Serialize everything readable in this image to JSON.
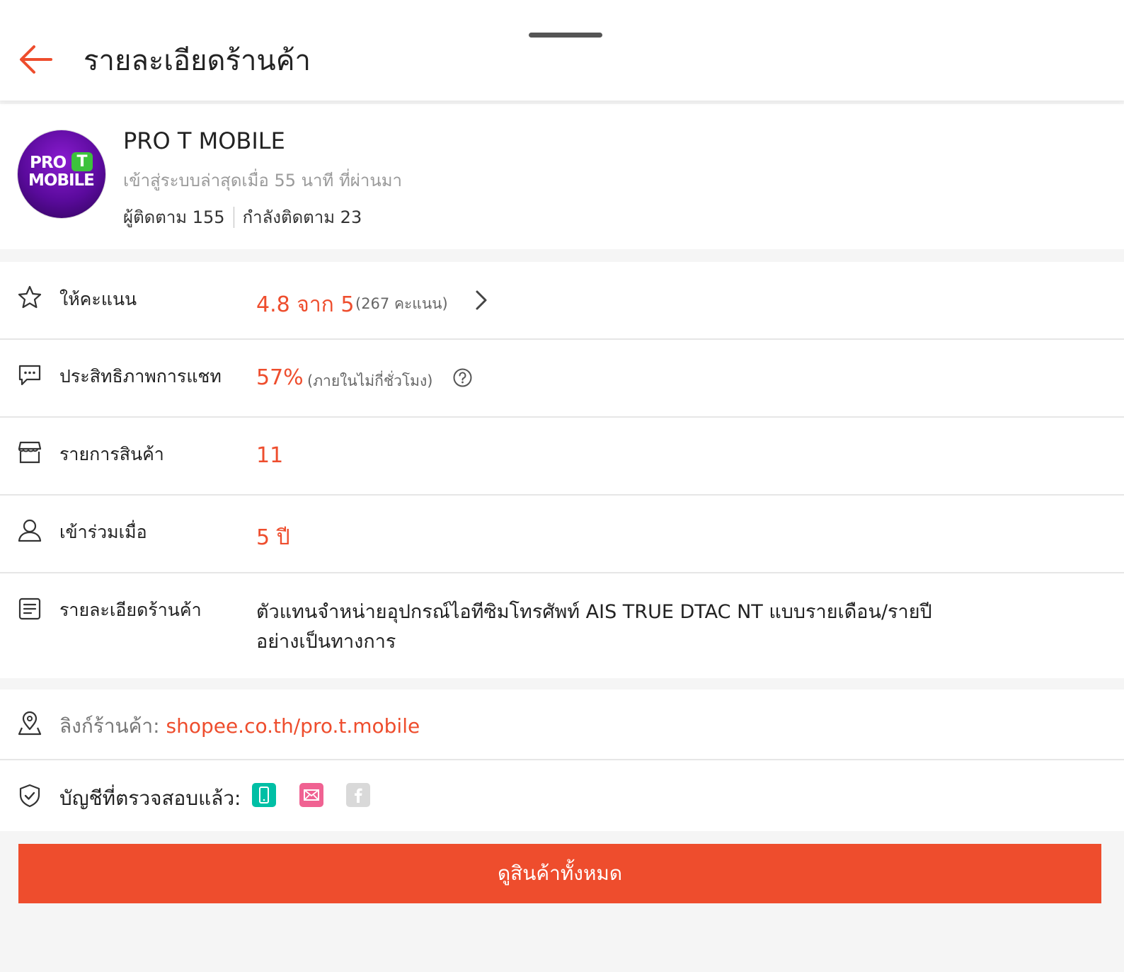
{
  "header": {
    "title": "รายละเอียดร้านค้า"
  },
  "shop": {
    "name": "PRO T MOBILE",
    "logo_line1": "PRO",
    "logo_bubble": "T",
    "logo_line2": "MOBILE",
    "last_active": "เข้าสู่ระบบล่าสุดเมื่อ 55 นาที ที่ผ่านมา",
    "followers": "ผู้ติดตาม 155",
    "following": "กำลังติดตาม 23"
  },
  "details": {
    "rating": {
      "label": "ให้คะแนน",
      "value": "4.8 จาก 5",
      "note": "(267 คะแนน)"
    },
    "chat": {
      "label": "ประสิทธิภาพการแชท",
      "value": "57%",
      "note": "(ภายในไม่กี่ชั่วโมง)"
    },
    "products": {
      "label": "รายการสินค้า",
      "value": "11"
    },
    "joined": {
      "label": "เข้าร่วมเมื่อ",
      "value": "5 ปี"
    },
    "description": {
      "label": "รายละเอียดร้านค้า",
      "line1": "ตัวแทนจำหน่ายอุปกรณ์ไอทีซิมโทรศัพท์ AIS TRUE DTAC NT แบบรายเดือน/รายปี",
      "line2": "อย่างเป็นทางการ"
    }
  },
  "links": {
    "shop_link_label": "ลิงก์ร้านค้า: ",
    "shop_link_url": "shopee.co.th/pro.t.mobile",
    "verified_label": "บัญชีที่ตรวจสอบแล้ว:",
    "verified_badges": [
      {
        "icon": "phone-icon",
        "color": "#00bfa5",
        "verified": true
      },
      {
        "icon": "email-icon",
        "color": "#f06292",
        "verified": true
      },
      {
        "icon": "facebook-icon",
        "color": "#d9d9d9",
        "verified": false
      }
    ]
  },
  "cta": {
    "label": "ดูสินค้าทั้งหมด"
  },
  "colors": {
    "accent": "#ee4d2d",
    "background": "#f5f5f5"
  }
}
